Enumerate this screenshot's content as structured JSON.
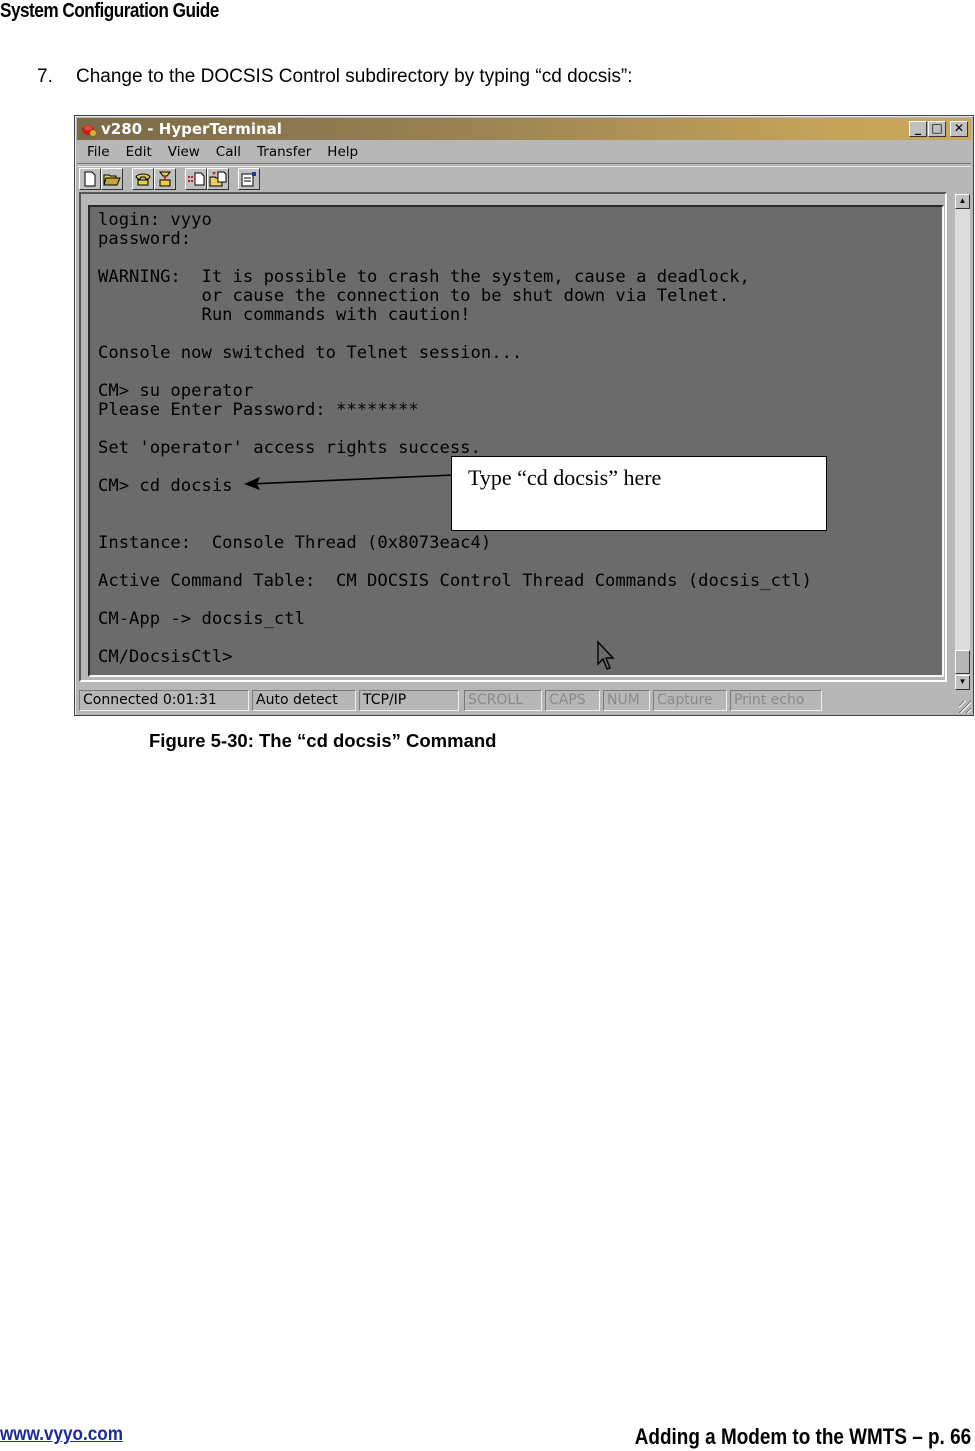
{
  "page": {
    "header_title": "System Configuration Guide",
    "step_number": "7.",
    "step_text": "Change to the DOCSIS Control subdirectory by typing “cd docsis”:",
    "figure_caption": "Figure 5-30: The “cd docsis” Command",
    "footer_link": "www.vyyo.com",
    "footer_section_page": "Adding a Modem to the WMTS – p. 66"
  },
  "window": {
    "title": "v280 - HyperTerminal",
    "controls": {
      "minimize": "_",
      "maximize": "□",
      "close": "✕"
    },
    "menu": [
      "File",
      "Edit",
      "View",
      "Call",
      "Transfer",
      "Help"
    ],
    "toolbar": [
      {
        "name": "new-connection",
        "icon": "new-file-icon"
      },
      {
        "name": "open",
        "icon": "open-folder-icon"
      },
      {
        "name": "connect",
        "icon": "phone-icon"
      },
      {
        "name": "disconnect",
        "icon": "hangup-phone-icon"
      },
      {
        "name": "send",
        "icon": "send-file-icon"
      },
      {
        "name": "receive",
        "icon": "receive-file-icon"
      },
      {
        "name": "properties",
        "icon": "properties-icon"
      }
    ],
    "terminal_lines": [
      "login: vyyo",
      "password:",
      "",
      "WARNING:  It is possible to crash the system, cause a deadlock,",
      "          or cause the connection to be shut down via Telnet.",
      "          Run commands with caution!",
      "",
      "Console now switched to Telnet session...",
      "",
      "CM> su operator",
      "Please Enter Password: ********",
      "",
      "Set 'operator' access rights success.",
      "",
      "CM> cd docsis",
      "",
      "",
      "Instance:  Console Thread (0x8073eac4)",
      "",
      "Active Command Table:  CM DOCSIS Control Thread Commands (docsis_ctl)",
      "",
      "CM-App -> docsis_ctl",
      "",
      "CM/DocsisCtl>"
    ],
    "status": [
      {
        "label": "Connected 0:01:31",
        "active": true
      },
      {
        "label": "Auto detect",
        "active": true
      },
      {
        "label": "TCP/IP",
        "active": true
      },
      {
        "label": "SCROLL",
        "active": false
      },
      {
        "label": "CAPS",
        "active": false
      },
      {
        "label": "NUM",
        "active": false
      },
      {
        "label": "Capture",
        "active": false
      },
      {
        "label": "Print echo",
        "active": false
      }
    ]
  },
  "callout": {
    "text": "Type “cd docsis” here"
  }
}
